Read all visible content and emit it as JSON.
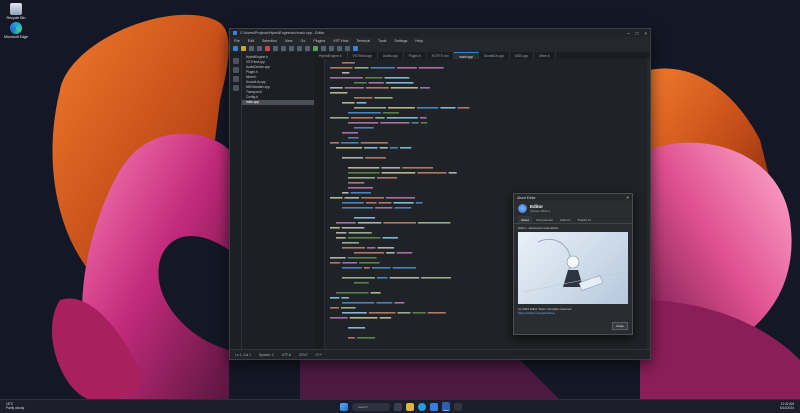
{
  "desktop": {
    "icons": [
      {
        "label": "Recycle Bin",
        "icon": "recycle-bin-icon"
      },
      {
        "label": "Microsoft Edge",
        "icon": "edge-icon"
      }
    ]
  },
  "editor": {
    "title": "C:\\Users\\Projects\\HybridEngine\\src\\main.cpp - Editor",
    "menu": [
      "File",
      "Edit",
      "Selection",
      "View",
      "Go",
      "Plugins",
      "VST Host",
      "Terminal",
      "Tools",
      "Settings",
      "Help"
    ],
    "tabs": [
      "HybridEngine.h",
      "VSTHost.cpp",
      "Audio.cpp",
      "Plugin.h",
      "NOTES.md",
      "main.cpp",
      "SoundLib.cpp",
      "MIDI.cpp",
      "Mixer.h"
    ],
    "active_tab": 5,
    "files": [
      "HybridEngine.h",
      "VSTHost.cpp",
      "AudioDevice.cpp",
      "Plugin.h",
      "Mixer.h",
      "SoundLib.cpp",
      "MIDIHandler.cpp",
      "Transport.h",
      "Config.h",
      "main.cpp"
    ],
    "selected_file": 9,
    "status": [
      "Ln 1, Col 1",
      "Spaces: 4",
      "UTF-8",
      "CRLF",
      "C++"
    ]
  },
  "about": {
    "window_title": "About Editor",
    "name": "Editor",
    "version": "Version 2024.1",
    "tabs": [
      "About",
      "Components",
      "Authors",
      "Thanks To"
    ],
    "caption": "Editor - Advanced Code Editor",
    "note": "(c) 2024 Editor Team. All rights reserved.",
    "link": "https://editor.example/about",
    "close": "Close"
  },
  "taskbar": {
    "weather_temp": "18°C",
    "weather_text": "Partly cloudy",
    "search_placeholder": "Search",
    "time": "11:42 AM",
    "date": "5/14/2024"
  },
  "colors": {
    "accent": "#3d7fd6",
    "wallpaper_orange": "#d8521e",
    "wallpaper_pink": "#e04aa0"
  }
}
